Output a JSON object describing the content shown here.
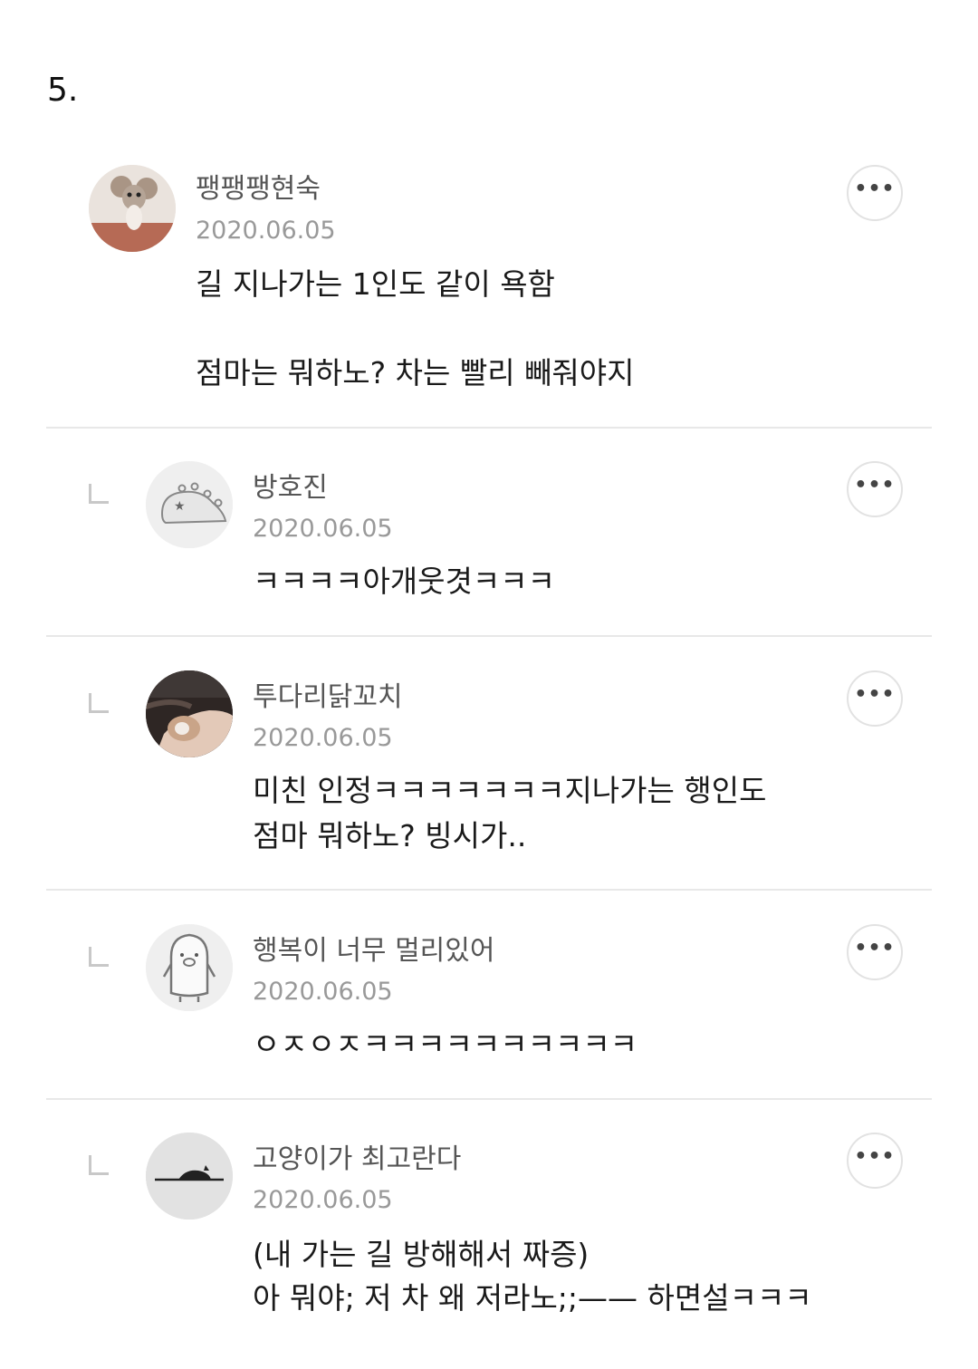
{
  "page_number": "5.",
  "comments": [
    {
      "author": "팽팽팽현숙",
      "date": "2020.06.05",
      "lines": [
        "길 지나가는 1인도 같이 욕함",
        "",
        "점마는 뭐하노? 차는 빨리 빼줘야지"
      ],
      "more_label": "•••",
      "avatar_icon": "mouse-avatar-icon"
    },
    {
      "author": "방호진",
      "date": "2020.06.05",
      "lines": [
        "ㅋㅋㅋㅋ아개웃겻ㅋㅋㅋ"
      ],
      "more_label": "•••",
      "avatar_icon": "dino-avatar-icon",
      "is_reply": true
    },
    {
      "author": "투다리닭꼬치",
      "date": "2020.06.05",
      "lines": [
        "미친 인정ㅋㅋㅋㅋㅋㅋㅋ지나가는 행인도",
        "점마 뭐하노? 빙시가.."
      ],
      "more_label": "•••",
      "avatar_icon": "photo-avatar-icon",
      "is_reply": true
    },
    {
      "author": "행복이 너무 멀리있어",
      "date": "2020.06.05",
      "lines": [
        "ㅇㅈㅇㅈㅋㅋㅋㅋㅋㅋㅋㅋㅋㅋ"
      ],
      "more_label": "•••",
      "avatar_icon": "penguin-avatar-icon",
      "is_reply": true
    },
    {
      "author": "고양이가 최고란다",
      "date": "2020.06.05",
      "lines": [
        "(내 가는 길 방해해서 짜증)",
        "아 뭐야; 저 차 왜 저라노;;—— 하면설ㅋㅋㅋ"
      ],
      "more_label": "•••",
      "avatar_icon": "cat-avatar-icon",
      "is_reply": true
    }
  ]
}
